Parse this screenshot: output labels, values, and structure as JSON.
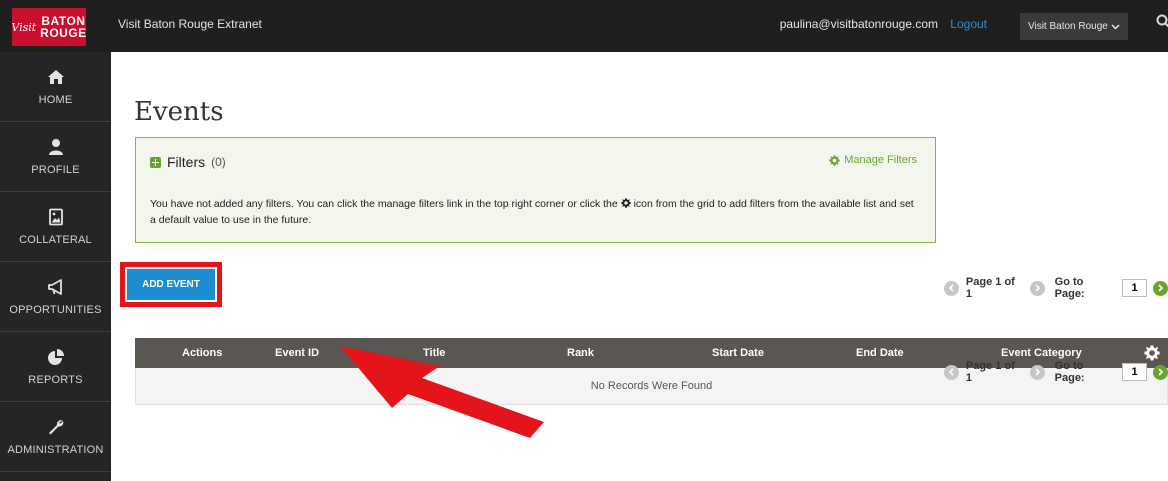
{
  "header": {
    "logo_visit": "Visit",
    "logo_line1": "BATON",
    "logo_line2": "ROUGE",
    "app_title": "Visit Baton Rouge Extranet",
    "user_email": "paulina@visitbatonrouge.com",
    "logout": "Logout",
    "org_select": "Visit Baton Rouge"
  },
  "sidebar": {
    "items": [
      {
        "label": "HOME",
        "icon": "home-icon"
      },
      {
        "label": "PROFILE",
        "icon": "user-icon"
      },
      {
        "label": "COLLATERAL",
        "icon": "image-file-icon"
      },
      {
        "label": "OPPORTUNITIES",
        "icon": "megaphone-icon"
      },
      {
        "label": "REPORTS",
        "icon": "pie-chart-icon"
      },
      {
        "label": "ADMINISTRATION",
        "icon": "wrench-icon"
      }
    ]
  },
  "main": {
    "page_title": "Events",
    "filters": {
      "title": "Filters",
      "count": "(0)",
      "manage_label": "Manage Filters",
      "message_before": "You have not added any filters. You can click the manage filters link in the top right corner or click the",
      "message_after": "icon from the grid to add filters from the available list and set a default value to use in the future."
    },
    "add_event_label": "ADD EVENT",
    "pager": {
      "page_text": "Page 1 of 1",
      "goto_label": "Go to Page:",
      "page_value": "1"
    },
    "grid": {
      "columns": [
        "Actions",
        "Event ID",
        "Title",
        "Rank",
        "Start Date",
        "End Date",
        "Event Category"
      ],
      "empty_text": "No Records Were Found"
    }
  },
  "colors": {
    "accent_blue": "#1d8cd3",
    "accent_green": "#6aa52b",
    "highlight_red": "#e4151a",
    "header_bg": "#1f1f1f",
    "sidebar_bg": "#252525",
    "grid_header_bg": "#5a5651"
  }
}
